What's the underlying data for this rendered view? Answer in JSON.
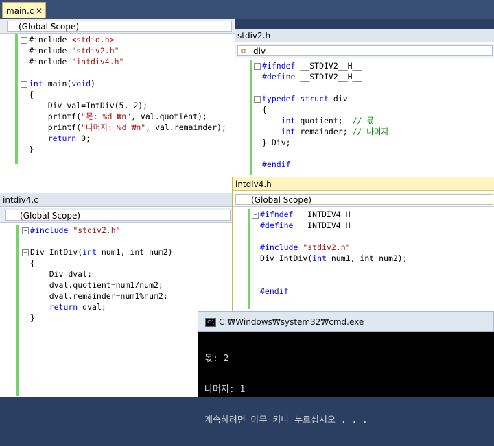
{
  "main_tab": {
    "title": "main.c",
    "close": "✕"
  },
  "main_pane": {
    "scope": "(Global Scope)",
    "lines": [
      {
        "pre": "#include ",
        "str": "<stdio.h>",
        "fold": "−"
      },
      {
        "pre": "#include ",
        "str": "\"stdiv2.h\""
      },
      {
        "pre": "#include ",
        "str": "\"intdiv4.h\""
      },
      {
        "pre": ""
      },
      {
        "kw": "int",
        "pre": " main(",
        "kw2": "void",
        "post": ")",
        "fold": "−"
      },
      {
        "pre": "{"
      },
      {
        "pre": "    Div val=IntDiv(5, 2);"
      },
      {
        "pre": "    printf(",
        "str": "\"몫: %d ₩n\"",
        "post": ", val.quotient);"
      },
      {
        "pre": "    printf(",
        "str": "\"나머지: %d ₩n\"",
        "post": ", val.remainder);"
      },
      {
        "kw": "    return",
        "pre": " 0;"
      },
      {
        "pre": "}"
      }
    ]
  },
  "stdiv2": {
    "title": "stdiv2.h",
    "member": "div",
    "lines": [
      {
        "kw": "#ifndef",
        "pre": " __STDIV2__H__",
        "fold": "−"
      },
      {
        "kw": "#define",
        "pre": " __STDIV2__H__"
      },
      {
        "pre": ""
      },
      {
        "kw": "typedef",
        "pre": " ",
        "kw2": "struct",
        "post": " div",
        "fold": "−"
      },
      {
        "pre": "{"
      },
      {
        "kw": "    int",
        "pre": " quotient;  ",
        "cm": "// 몫"
      },
      {
        "kw": "    int",
        "pre": " remainder; ",
        "cm": "// 나머지"
      },
      {
        "pre": "} Div;"
      },
      {
        "pre": ""
      },
      {
        "kw": "#endif",
        "pre": ""
      }
    ]
  },
  "intdiv4_c": {
    "title": "intdiv4.c",
    "scope": "(Global Scope)",
    "lines": [
      {
        "kw": "#include",
        "pre": " ",
        "str": "\"stdiv2.h\"",
        "fold": "−"
      },
      {
        "pre": ""
      },
      {
        "pre": "Div IntDiv(",
        "kw2": "int",
        "post": " num1, int num2)",
        "fold": "−"
      },
      {
        "pre": "{"
      },
      {
        "pre": "    Div dval;"
      },
      {
        "pre": "    dval.quotient=num1/num2;"
      },
      {
        "pre": "    dval.remainder=num1%num2;"
      },
      {
        "kw": "    return",
        "pre": " dval;"
      },
      {
        "pre": "}"
      }
    ]
  },
  "intdiv4_h": {
    "title": "intdiv4.h",
    "scope": "(Global Scope)",
    "lines": [
      {
        "kw": "#ifndef",
        "pre": " __INTDIV4_H__",
        "fold": "−"
      },
      {
        "kw": "#define",
        "pre": " __INTDIV4_H__"
      },
      {
        "pre": ""
      },
      {
        "kw": "#include",
        "pre": " ",
        "str": "\"stdiv2.h\""
      },
      {
        "pre": "Div IntDiv(",
        "kw2": "int",
        "post": " num1, int num2);"
      },
      {
        "pre": ""
      },
      {
        "pre": ""
      },
      {
        "kw": "#endif",
        "pre": ""
      }
    ]
  },
  "cmd": {
    "title": "C:₩Windows₩system32₩cmd.exe",
    "icon": "C:\\",
    "output": [
      "몫: 2",
      "나머지: 1",
      "계속하려면 아무 키나 누르십시오 . . ."
    ]
  },
  "colors": {
    "keyword": "#0000ff",
    "string": "#a31515",
    "comment": "#008000",
    "gutter": "#76d468"
  }
}
